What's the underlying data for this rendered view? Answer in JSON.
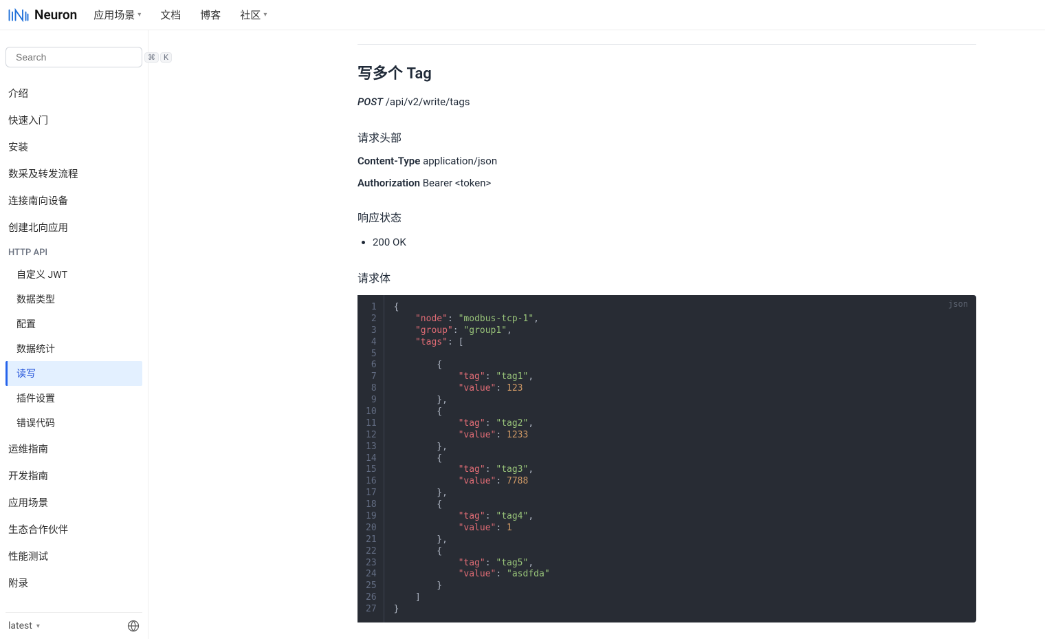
{
  "brand": "Neuron",
  "topnav": [
    {
      "label": "应用场景",
      "chev": true
    },
    {
      "label": "文档",
      "chev": false
    },
    {
      "label": "博客",
      "chev": false
    },
    {
      "label": "社区",
      "chev": true
    }
  ],
  "search": {
    "placeholder": "Search",
    "kbd1": "⌘",
    "kbd2": "K"
  },
  "sidebar": {
    "top": [
      "介绍",
      "快速入门",
      "安装",
      "数采及转发流程",
      "连接南向设备",
      "创建北向应用"
    ],
    "section": "HTTP API",
    "subs": [
      {
        "label": "自定义 JWT",
        "active": false
      },
      {
        "label": "数据类型",
        "active": false
      },
      {
        "label": "配置",
        "active": false
      },
      {
        "label": "数据统计",
        "active": false
      },
      {
        "label": "读写",
        "active": true
      },
      {
        "label": "插件设置",
        "active": false
      },
      {
        "label": "错误代码",
        "active": false
      }
    ],
    "bottom": [
      "运维指南",
      "开发指南",
      "应用场景",
      "生态合作伙伴",
      "性能测试",
      "附录"
    ]
  },
  "footer": {
    "version": "latest"
  },
  "page": {
    "title": "写多个 Tag",
    "method": "POST",
    "path": "/api/v2/write/tags",
    "sec_headers": "请求头部",
    "hdr_ct_k": "Content-Type",
    "hdr_ct_v": "application/json",
    "hdr_auth_k": "Authorization",
    "hdr_auth_v": "Bearer <token>",
    "sec_status": "响应状态",
    "status_items": [
      "200 OK"
    ],
    "sec_body": "请求体",
    "code_lang": "json",
    "code_lines": [
      [
        [
          "pun",
          "{"
        ]
      ],
      [
        [
          "pun",
          "    "
        ],
        [
          "key",
          "\"node\""
        ],
        [
          "pun",
          ": "
        ],
        [
          "str",
          "\"modbus-tcp-1\""
        ],
        [
          "pun",
          ","
        ]
      ],
      [
        [
          "pun",
          "    "
        ],
        [
          "key",
          "\"group\""
        ],
        [
          "pun",
          ": "
        ],
        [
          "str",
          "\"group1\""
        ],
        [
          "pun",
          ","
        ]
      ],
      [
        [
          "pun",
          "    "
        ],
        [
          "key",
          "\"tags\""
        ],
        [
          "pun",
          ": ["
        ]
      ],
      [
        [
          "pun",
          ""
        ]
      ],
      [
        [
          "pun",
          "        {"
        ]
      ],
      [
        [
          "pun",
          "            "
        ],
        [
          "key",
          "\"tag\""
        ],
        [
          "pun",
          ": "
        ],
        [
          "str",
          "\"tag1\""
        ],
        [
          "pun",
          ","
        ]
      ],
      [
        [
          "pun",
          "            "
        ],
        [
          "key",
          "\"value\""
        ],
        [
          "pun",
          ": "
        ],
        [
          "num",
          "123"
        ]
      ],
      [
        [
          "pun",
          "        },"
        ]
      ],
      [
        [
          "pun",
          "        {"
        ]
      ],
      [
        [
          "pun",
          "            "
        ],
        [
          "key",
          "\"tag\""
        ],
        [
          "pun",
          ": "
        ],
        [
          "str",
          "\"tag2\""
        ],
        [
          "pun",
          ","
        ]
      ],
      [
        [
          "pun",
          "            "
        ],
        [
          "key",
          "\"value\""
        ],
        [
          "pun",
          ": "
        ],
        [
          "num",
          "1233"
        ]
      ],
      [
        [
          "pun",
          "        },"
        ]
      ],
      [
        [
          "pun",
          "        {"
        ]
      ],
      [
        [
          "pun",
          "            "
        ],
        [
          "key",
          "\"tag\""
        ],
        [
          "pun",
          ": "
        ],
        [
          "str",
          "\"tag3\""
        ],
        [
          "pun",
          ","
        ]
      ],
      [
        [
          "pun",
          "            "
        ],
        [
          "key",
          "\"value\""
        ],
        [
          "pun",
          ": "
        ],
        [
          "num",
          "7788"
        ]
      ],
      [
        [
          "pun",
          "        },"
        ]
      ],
      [
        [
          "pun",
          "        {"
        ]
      ],
      [
        [
          "pun",
          "            "
        ],
        [
          "key",
          "\"tag\""
        ],
        [
          "pun",
          ": "
        ],
        [
          "str",
          "\"tag4\""
        ],
        [
          "pun",
          ","
        ]
      ],
      [
        [
          "pun",
          "            "
        ],
        [
          "key",
          "\"value\""
        ],
        [
          "pun",
          ": "
        ],
        [
          "num",
          "1"
        ]
      ],
      [
        [
          "pun",
          "        },"
        ]
      ],
      [
        [
          "pun",
          "        {"
        ]
      ],
      [
        [
          "pun",
          "            "
        ],
        [
          "key",
          "\"tag\""
        ],
        [
          "pun",
          ": "
        ],
        [
          "str",
          "\"tag5\""
        ],
        [
          "pun",
          ","
        ]
      ],
      [
        [
          "pun",
          "            "
        ],
        [
          "key",
          "\"value\""
        ],
        [
          "pun",
          ": "
        ],
        [
          "str",
          "\"asdfda\""
        ]
      ],
      [
        [
          "pun",
          "        }"
        ]
      ],
      [
        [
          "pun",
          "    ]"
        ]
      ],
      [
        [
          "pun",
          "}"
        ]
      ]
    ]
  }
}
